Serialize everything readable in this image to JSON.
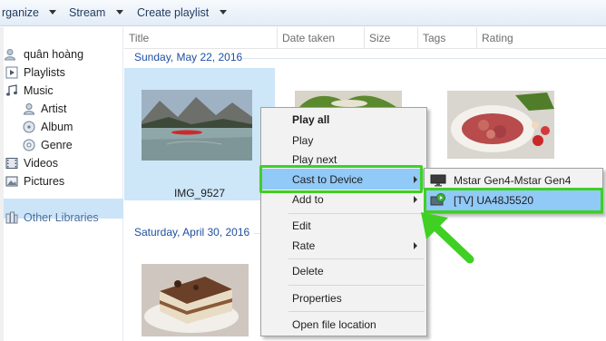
{
  "toolbar": {
    "organize_label": "rganize",
    "stream_label": "Stream",
    "create_playlist_label": "Create playlist"
  },
  "nav": {
    "user": "quân hoàng",
    "playlists": "Playlists",
    "music": "Music",
    "artist": "Artist",
    "album": "Album",
    "genre": "Genre",
    "videos": "Videos",
    "pictures": "Pictures",
    "other_libraries": "Other Libraries"
  },
  "columns": [
    "Title",
    "Date taken",
    "Size",
    "Tags",
    "Rating"
  ],
  "groups": {
    "first": "Sunday, May 22, 2016",
    "second": "Saturday, April 30, 2016"
  },
  "items": {
    "first_caption": "IMG_9527"
  },
  "context_menu": {
    "play_all": "Play all",
    "play": "Play",
    "play_next": "Play next",
    "cast_to_device": "Cast to Device",
    "add_to": "Add to",
    "edit": "Edit",
    "rate": "Rate",
    "delete": "Delete",
    "properties": "Properties",
    "open_file_location": "Open file location"
  },
  "submenu": {
    "device_1": "Mstar Gen4-Mstar Gen4",
    "device_2": "[TV] UA48J5520"
  },
  "colors": {
    "highlight": "#91c9f7",
    "annotation_green": "#3fd023",
    "nav_selected": "#cce4f7",
    "group_header": "#1e50a0"
  }
}
